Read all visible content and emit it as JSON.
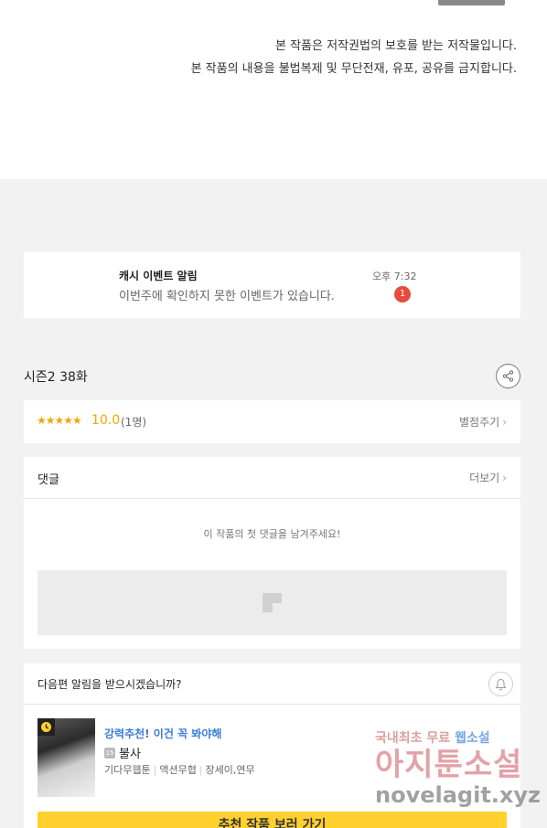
{
  "copyright": {
    "line1": "본 작품은 저작권법의 보호를 받는 저작물입니다.",
    "line2": "본 작품의 내용을 불법복제 및 무단전재, 유포, 공유를 금지합니다."
  },
  "notice": {
    "title": "캐시 이벤트 알림",
    "body": "이번주에 확인하지 못한 이벤트가 있습니다.",
    "time": "오후 7:32",
    "badge": "1"
  },
  "episode": {
    "title": "시즌2 38화"
  },
  "rating": {
    "stars": "★★★★★",
    "score": "10.0",
    "count": "(1명)",
    "rate_button": "별점주기"
  },
  "comments": {
    "title": "댓글",
    "more": "더보기",
    "empty": "이 작품의 첫 댓글을 남겨주세요!"
  },
  "next": {
    "question": "다음편 알림을 받으시겠습니까?",
    "recommend_tag": "강력추천! 이건 꼭 봐야해",
    "age_rating": "15",
    "title": "불사",
    "genre": "기다무웹툰",
    "category": "액션무협",
    "authors": "장세이,연무",
    "cta": "추천 작품 보러 가기"
  },
  "watermark": {
    "line1_a": "국내최초 무료",
    "line1_b": "웹소설",
    "line2": "아지툰소설",
    "line3": "novelagit.xyz"
  },
  "colors": {
    "accent_yellow": "#ffd02e",
    "star": "#f0a800",
    "badge_red": "#e84b3c",
    "link_blue": "#3b7bd9"
  }
}
